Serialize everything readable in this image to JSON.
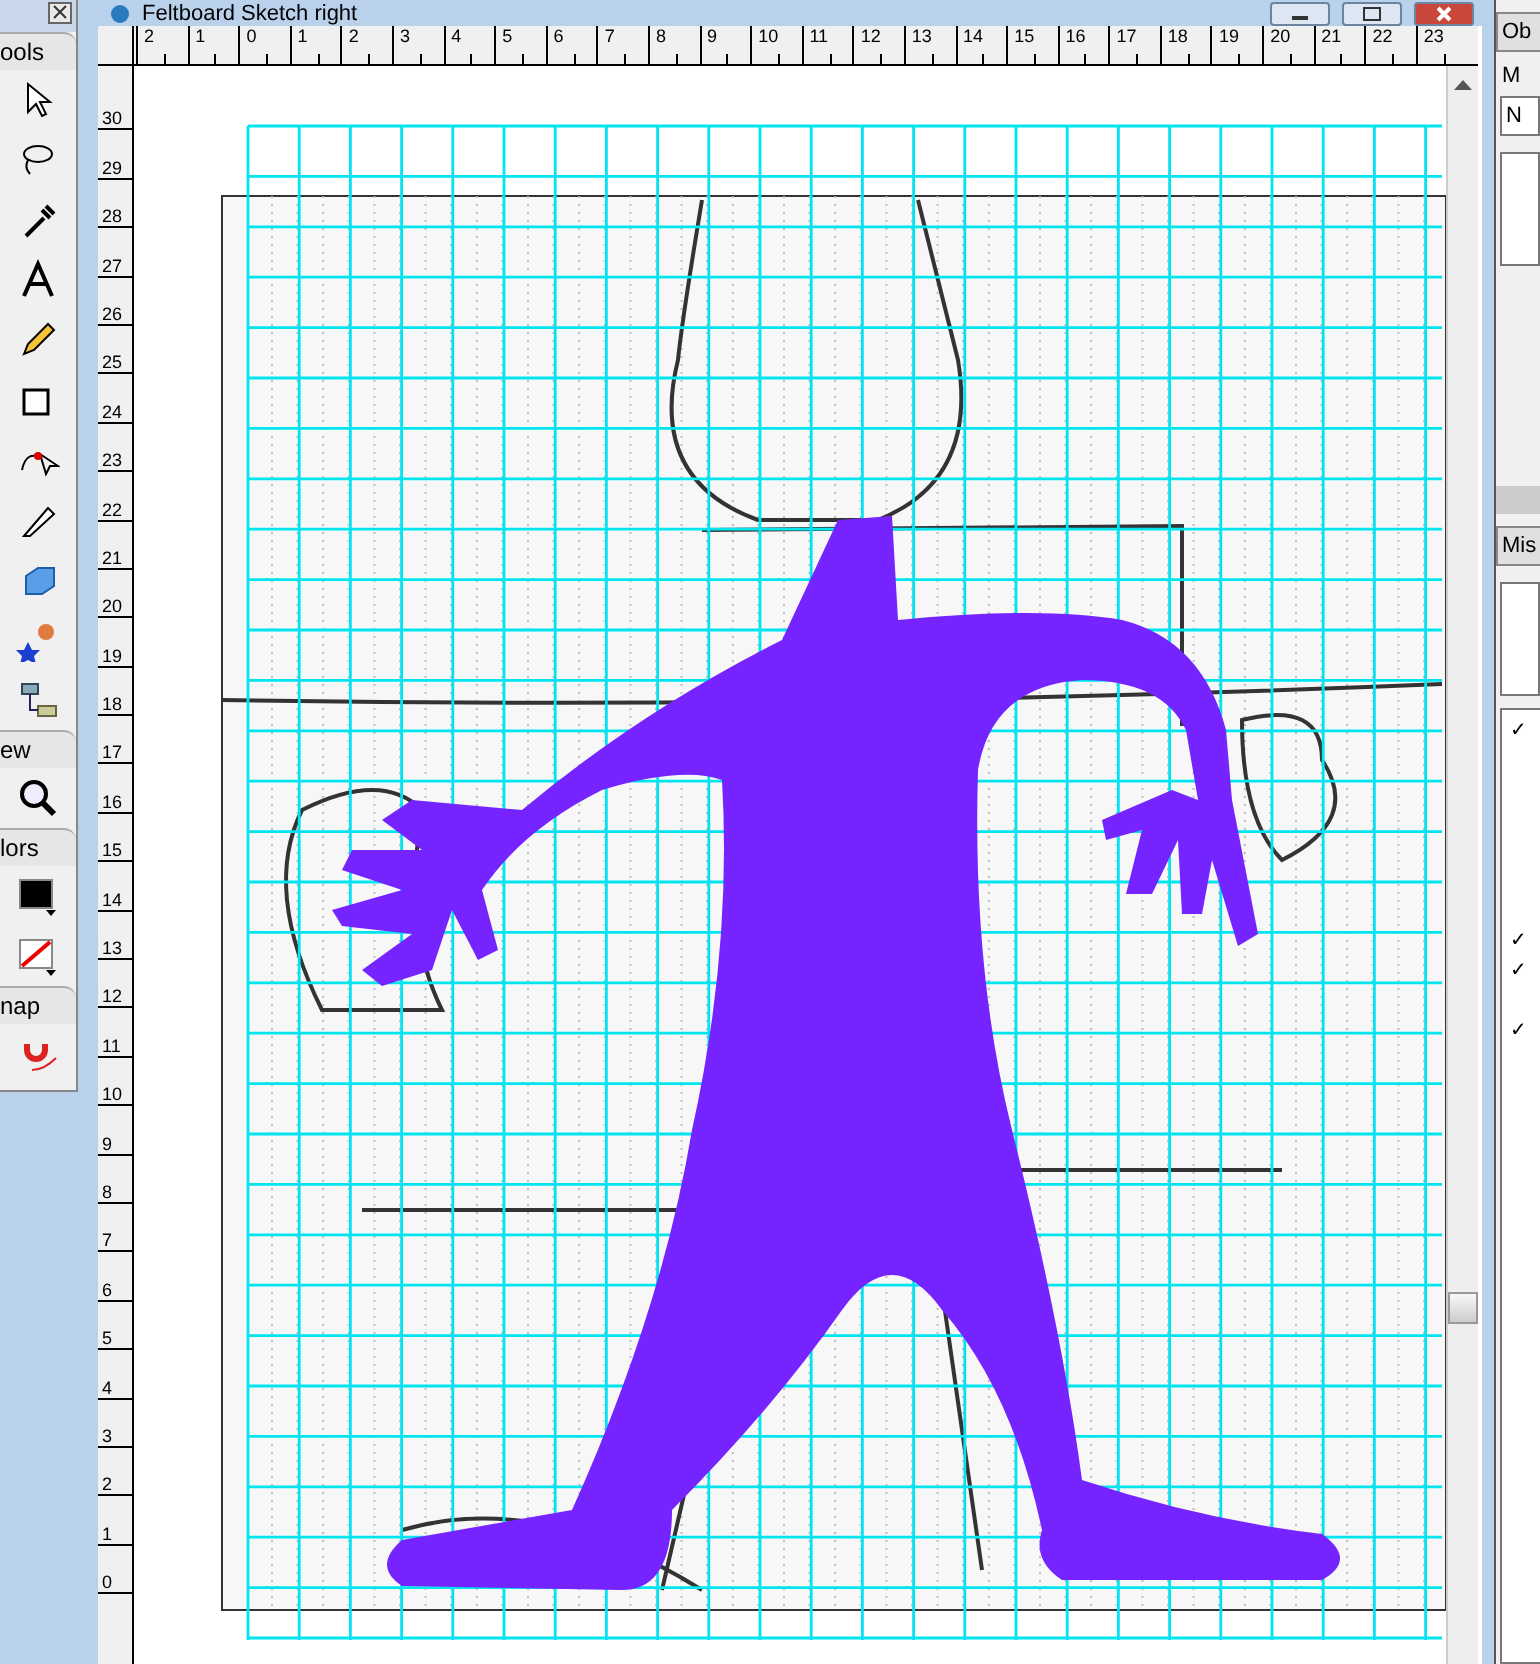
{
  "window": {
    "title": "Feltboard Sketch right"
  },
  "tools_panel": {
    "sections": [
      {
        "label": "ools",
        "kind": "tools"
      },
      {
        "label": "ew",
        "kind": "view"
      },
      {
        "label": "lors",
        "kind": "colors"
      },
      {
        "label": "nap",
        "kind": "snap"
      }
    ]
  },
  "rulers": {
    "horizontal": [
      "2",
      "1",
      "0",
      "1",
      "2",
      "3",
      "4",
      "5",
      "6",
      "7",
      "8",
      "9",
      "10",
      "11",
      "12",
      "13",
      "14",
      "15",
      "16",
      "17",
      "18",
      "19",
      "20",
      "21",
      "22",
      "23"
    ],
    "vertical": [
      "30",
      "29",
      "28",
      "27",
      "26",
      "25",
      "24",
      "23",
      "22",
      "21",
      "20",
      "19",
      "18",
      "17",
      "16",
      "15",
      "14",
      "13",
      "12",
      "11",
      "10",
      "9",
      "8",
      "7",
      "6",
      "5",
      "4",
      "3",
      "2",
      "1",
      "0"
    ]
  },
  "right_panel": {
    "top_tab": "Ob",
    "field_label": "M",
    "field_value": "N",
    "bottom_tab": "Mis",
    "checkmarks": [
      "✓",
      "✓",
      "✓",
      "✓"
    ]
  }
}
